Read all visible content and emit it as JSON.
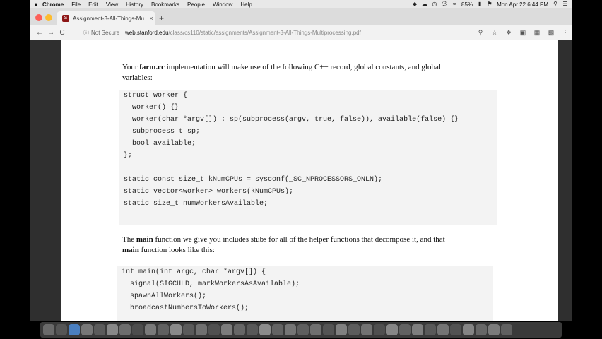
{
  "menubar": {
    "apple": "",
    "items": [
      "Chrome",
      "File",
      "Edit",
      "View",
      "History",
      "Bookmarks",
      "People",
      "Window",
      "Help"
    ],
    "battery": "85%",
    "clock": "Mon Apr 22  6:44 PM"
  },
  "tab": {
    "title": "Assignment-3-All-Things-Mu",
    "close": "×",
    "new_tab": "+"
  },
  "address": {
    "back": "←",
    "forward": "→",
    "reload": "C",
    "security": "Not Secure",
    "host": "web.stanford.edu",
    "path": "/class/cs110/static/assignments/Assignment-3-All-Things-Multiprocessing.pdf"
  },
  "doc": {
    "p1_a": "Your ",
    "p1_b": "farm.cc",
    "p1_c": " implementation will make use of the following C++ record, global constants, and global",
    "p1_d": "variables:",
    "code1": [
      "struct worker {",
      "  worker() {}",
      "  worker(char *argv[]) : sp(subprocess(argv, true, false)), available(false) {}",
      "  subprocess_t sp;",
      "  bool available;",
      "};",
      "",
      "static const size_t kNumCPUs = sysconf(_SC_NPROCESSORS_ONLN);",
      "static vector<worker> workers(kNumCPUs);",
      "static size_t numWorkersAvailable;"
    ],
    "p2_a": "The ",
    "p2_b": "main",
    "p2_c": " function we give you includes stubs for all of the helper functions that decompose it, and that",
    "p2_d": "main",
    "p2_e": " function looks like this:",
    "code2": [
      "int main(int argc, char *argv[]) {",
      "  signal(SIGCHLD, markWorkersAsAvailable);",
      "  spawnAllWorkers();",
      "  broadcastNumbersToWorkers();"
    ]
  }
}
